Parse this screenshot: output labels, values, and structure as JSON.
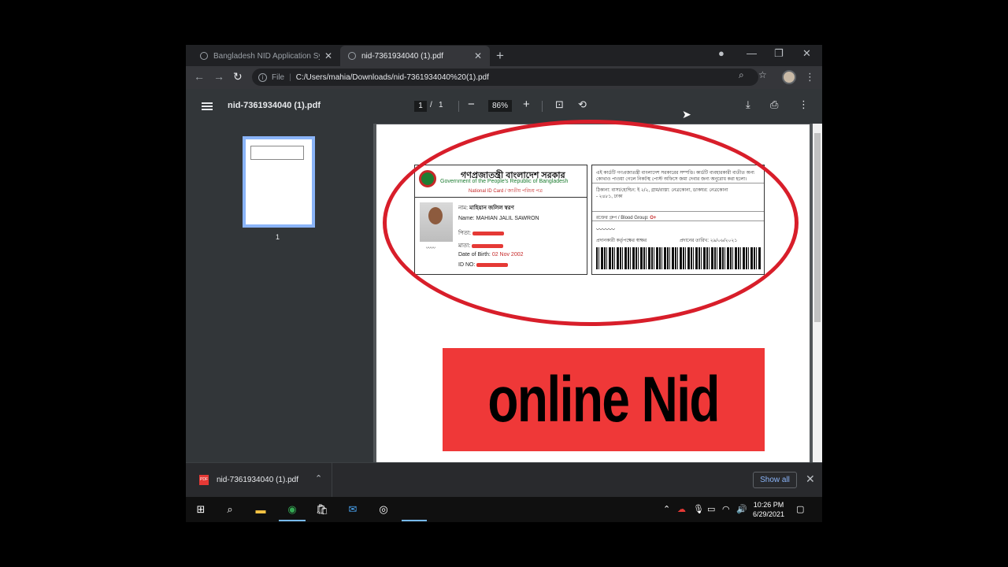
{
  "browser": {
    "tabs": [
      {
        "label": "Bangladesh NID Application Syst",
        "active": false
      },
      {
        "label": "nid-7361934040 (1).pdf",
        "active": true
      }
    ],
    "address": {
      "scheme": "File",
      "url": "C:/Users/mahia/Downloads/nid-7361934040%20(1).pdf"
    }
  },
  "pdf_viewer": {
    "title": "nid-7361934040 (1).pdf",
    "page_current": "1",
    "page_separator": "/",
    "page_total": "1",
    "zoom": "86%",
    "thumbnail_number": "1"
  },
  "nid_card": {
    "bn_title": "গণপ্রজাতন্ত্রী বাংলাদেশ সরকার",
    "en_title": "Government of the People's Republic of Bangladesh",
    "card_label": "National ID Card / জাতীয় পরিচয় পত্র",
    "name_bn_label": "নাম:",
    "name_bn_value": "মাহিয়ান জলিল স্বরণ",
    "name_label": "Name:",
    "name_value": "MAHIAN JALIL SAWRON",
    "father_label": "পিতা:",
    "mother_label": "মাতা:",
    "dob_label": "Date of Birth:",
    "dob_value": "02 Nov 2002",
    "id_label": "ID NO:",
    "back_line1": "এই কার্ডটি গণপ্রজাতন্ত্রী বাংলাদেশ সরকারের সম্পত্তি। কার্ডটি ব্যবহারকারী ব্যতীত অন্য",
    "back_line2": "কোথাও পাওয়া গেলে নিকটস্থ পোস্ট অফিসে জমা দেবার জন্য অনুরোধ করা হলো।",
    "address_line": "ঠিকানা: বাসা/হোল্ডিং: ই ২/২, গ্রাম/রাস্তা: নেত্রকোনা, ডাকঘর: নেত্রকোনা",
    "address_line2": "- ২৪৮১, ঢাকা",
    "blood_group_label": "রক্তের গ্রুপ / Blood Group:",
    "blood_group_value": "O+",
    "issuer_label": "প্রদানকারী কর্তৃপক্ষের স্বাক্ষর",
    "issue_date_label": "প্রদানের তারিখ:",
    "issue_date_value": "২৯/০৬/২০২১"
  },
  "overlay": {
    "banner_text": "online Nid",
    "ellipse_color": "#d81e2a",
    "banner_color": "#ef3838"
  },
  "download_shelf": {
    "file_name": "nid-7361934040 (1).pdf",
    "show_all": "Show all"
  },
  "taskbar": {
    "time": "10:26 PM",
    "date": "6/29/2021"
  }
}
